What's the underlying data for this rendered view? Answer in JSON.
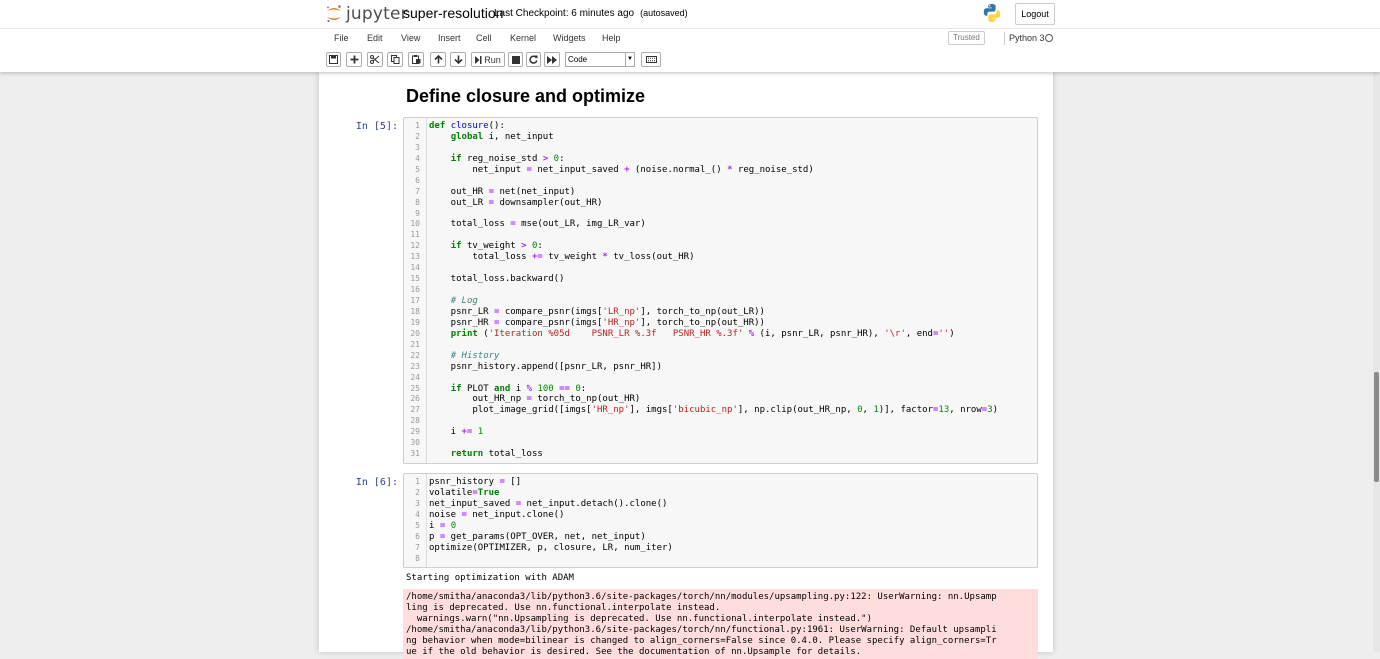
{
  "header": {
    "logo_text": "jupyter",
    "notebook_name": "super-resolution",
    "checkpoint": "Last Checkpoint: 6 minutes ago",
    "autosaved": "(autosaved)",
    "logout_label": "Logout"
  },
  "menubar": {
    "items": [
      "File",
      "Edit",
      "View",
      "Insert",
      "Cell",
      "Kernel",
      "Widgets",
      "Help"
    ],
    "trusted": "Trusted",
    "kernel_name": "Python 3"
  },
  "toolbar": {
    "run_label": "Run",
    "cell_type": "Code"
  },
  "heading": "Define closure and optimize",
  "cells": [
    {
      "prompt": "In [5]:",
      "lines": [
        "def closure():",
        "    global i, net_input",
        "",
        "    if reg_noise_std > 0:",
        "        net_input = net_input_saved + (noise.normal_() * reg_noise_std)",
        "",
        "    out_HR = net(net_input)",
        "    out_LR = downsampler(out_HR)",
        "",
        "    total_loss = mse(out_LR, img_LR_var)",
        "",
        "    if tv_weight > 0:",
        "        total_loss += tv_weight * tv_loss(out_HR)",
        "",
        "    total_loss.backward()",
        "",
        "    # Log",
        "    psnr_LR = compare_psnr(imgs['LR_np'], torch_to_np(out_LR))",
        "    psnr_HR = compare_psnr(imgs['HR_np'], torch_to_np(out_HR))",
        "    print ('Iteration %05d    PSNR_LR %.3f   PSNR_HR %.3f' % (i, psnr_LR, psnr_HR), '\\r', end='')",
        "",
        "    # History",
        "    psnr_history.append([psnr_LR, psnr_HR])",
        "",
        "    if PLOT and i % 100 == 0:",
        "        out_HR_np = torch_to_np(out_HR)",
        "        plot_image_grid([imgs['HR_np'], imgs['bicubic_np'], np.clip(out_HR_np, 0, 1)], factor=13, nrow=3)",
        "",
        "    i += 1",
        "",
        "    return total_loss"
      ]
    },
    {
      "prompt": "In [6]:",
      "lines": [
        "psnr_history = []",
        "volatile=True",
        "net_input_saved = net_input.detach().clone()",
        "noise = net_input.clone()",
        "i = 0",
        "p = get_params(OPT_OVER, net, net_input)",
        "optimize(OPTIMIZER, p, closure, LR, num_iter)",
        ""
      ],
      "stdout": "Starting optimization with ADAM",
      "stderr": [
        "/home/smitha/anaconda3/lib/python3.6/site-packages/torch/nn/modules/upsampling.py:122: UserWarning: nn.Upsamp",
        "ling is deprecated. Use nn.functional.interpolate instead.",
        "  warnings.warn(\"nn.Upsampling is deprecated. Use nn.functional.interpolate instead.\")",
        "/home/smitha/anaconda3/lib/python3.6/site-packages/torch/nn/functional.py:1961: UserWarning: Default upsampli",
        "ng behavior when mode=bilinear is changed to align_corners=False since 0.4.0. Please specify align_corners=Tr",
        "ue if the old behavior is desired. See the documentation of nn.Upsample for details."
      ]
    }
  ]
}
